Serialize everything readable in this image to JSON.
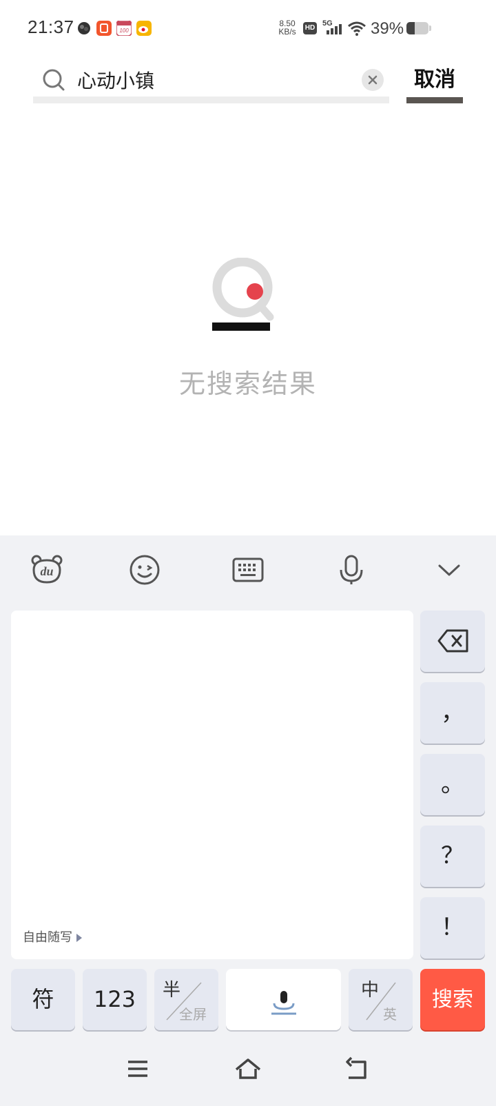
{
  "status_bar": {
    "time": "21:37",
    "app_icons": [
      "app-icon",
      "taobao-special-icon",
      "app-100-icon",
      "weibo-icon"
    ],
    "net_speed_value": "8.50",
    "net_speed_unit": "KB/s",
    "hd_badge": "HD",
    "network_type": "5G",
    "battery_percent": "39%",
    "battery_level": 0.39
  },
  "search": {
    "query": "心动小镇",
    "cancel_label": "取消"
  },
  "empty_state": {
    "message": "无搜索结果",
    "accent_color": "#e5434d"
  },
  "keyboard": {
    "toolbar_icons": [
      "du-bear-icon",
      "emoji-icon",
      "keyboard-icon",
      "microphone-icon",
      "collapse-chevron-icon"
    ],
    "free_write_label": "自由随写",
    "side_keys": {
      "backspace_icon": "backspace-icon",
      "comma": "，",
      "period": "。",
      "question": "？",
      "exclamation": "！"
    },
    "bottom_keys": {
      "symbol": "符",
      "numbers": "123",
      "half_label": "半",
      "full_label": "全屏",
      "space_icon": "space-mic-icon",
      "zh_label": "中",
      "en_label": "英",
      "search_label": "搜索"
    },
    "search_key_color": "#ff5a45"
  },
  "nav_bar": {
    "icons": [
      "menu-icon",
      "home-icon",
      "back-icon"
    ]
  }
}
